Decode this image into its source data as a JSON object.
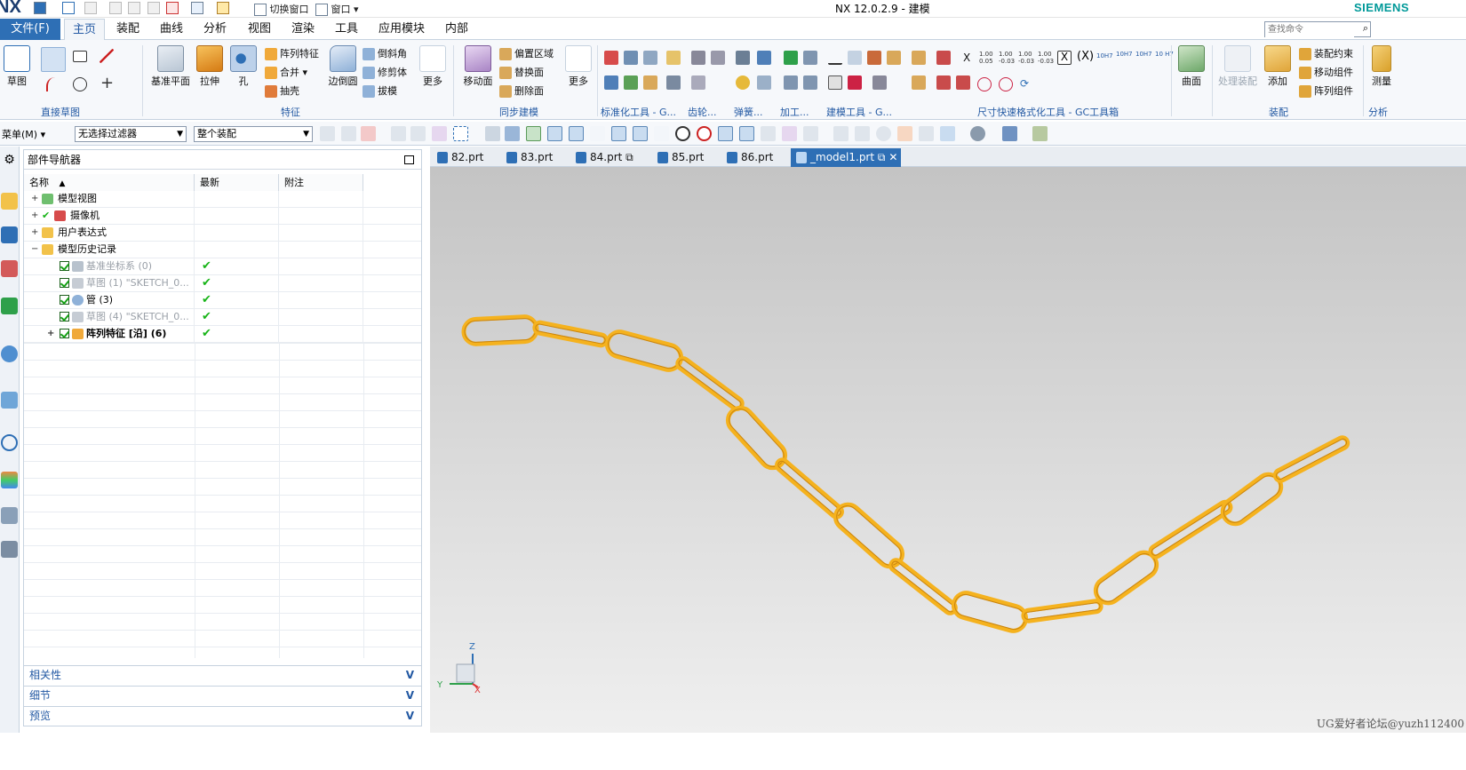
{
  "titlebar": {
    "logo": "NX",
    "title": "NX 12.0.2.9 - 建模",
    "brand": "SIEMENS",
    "switch_window": "切换窗口",
    "window_menu": "窗口"
  },
  "tabs": {
    "file": "文件(F)",
    "items": [
      "主页",
      "装配",
      "曲线",
      "分析",
      "视图",
      "渲染",
      "工具",
      "应用模块",
      "内部"
    ]
  },
  "ribbon": {
    "sketch": "草图",
    "datum_plane": "基准平面",
    "extrude": "拉伸",
    "hole": "孔",
    "pattern_feature": "阵列特征",
    "unite": "合并",
    "shell": "抽壳",
    "edge_blend": "边倒圆",
    "chamfer": "倒斜角",
    "trim_body": "修剪体",
    "draft": "拔模",
    "more": "更多",
    "move_face": "移动面",
    "offset_region": "偏置区域",
    "replace_face": "替换面",
    "delete_face": "删除面",
    "more2": "更多",
    "surface": "曲面",
    "process_assembly": "处理装配",
    "add": "添加",
    "assembly_constraints": "装配约束",
    "move_component": "移动组件",
    "pattern_component": "阵列组件",
    "measure": "测量",
    "groups": {
      "direct_sketch": "直接草图",
      "feature": "特征",
      "sync_modeling": "同步建模",
      "std_tools": "标准化工具 - G...",
      "gear": "齿轮...",
      "spring": "弹簧...",
      "machining": "加工...",
      "modeling_tools": "建模工具 - G...",
      "dim_format": "尺寸快速格式化工具 - GC工具箱",
      "assembly": "装配",
      "analysis": "分析"
    },
    "dim_labels": [
      "X",
      "1.00 0.05",
      "1.00 -0.03",
      "1.00 -0.03",
      "1.00 -0.03",
      "10H7",
      "10H7",
      "10H7",
      "10 H7"
    ]
  },
  "search": {
    "placeholder": "查找命令"
  },
  "toolbar": {
    "menu": "菜单(M)",
    "filter": "无选择过滤器",
    "scope": "整个装配"
  },
  "navigator": {
    "title": "部件导航器",
    "columns": [
      "名称",
      "最新",
      "附注"
    ],
    "rows": [
      {
        "label": "模型视图",
        "latest": ""
      },
      {
        "label": "摄像机",
        "latest": ""
      },
      {
        "label": "用户表达式",
        "latest": ""
      },
      {
        "label": "模型历史记录",
        "latest": ""
      },
      {
        "label": "基准坐标系 (0)",
        "latest": "✔"
      },
      {
        "label": "草图 (1) \"SKETCH_0...",
        "latest": "✔"
      },
      {
        "label": "管 (3)",
        "latest": "✔"
      },
      {
        "label": "草图 (4) \"SKETCH_0...",
        "latest": "✔"
      },
      {
        "label": "阵列特征 [沿] (6)",
        "latest": "✔"
      }
    ],
    "panels": [
      "相关性",
      "细节",
      "预览"
    ]
  },
  "doc_tabs": [
    "82.prt",
    "83.prt",
    "84.prt",
    "85.prt",
    "86.prt",
    "_model1.prt"
  ],
  "triad": {
    "z": "Z",
    "y": "Y",
    "x": "X"
  },
  "watermark": "UG爱好者论坛@yuzh112400",
  "colors": {
    "chain": "#f5b21e",
    "accent": "#2e6fb5"
  }
}
